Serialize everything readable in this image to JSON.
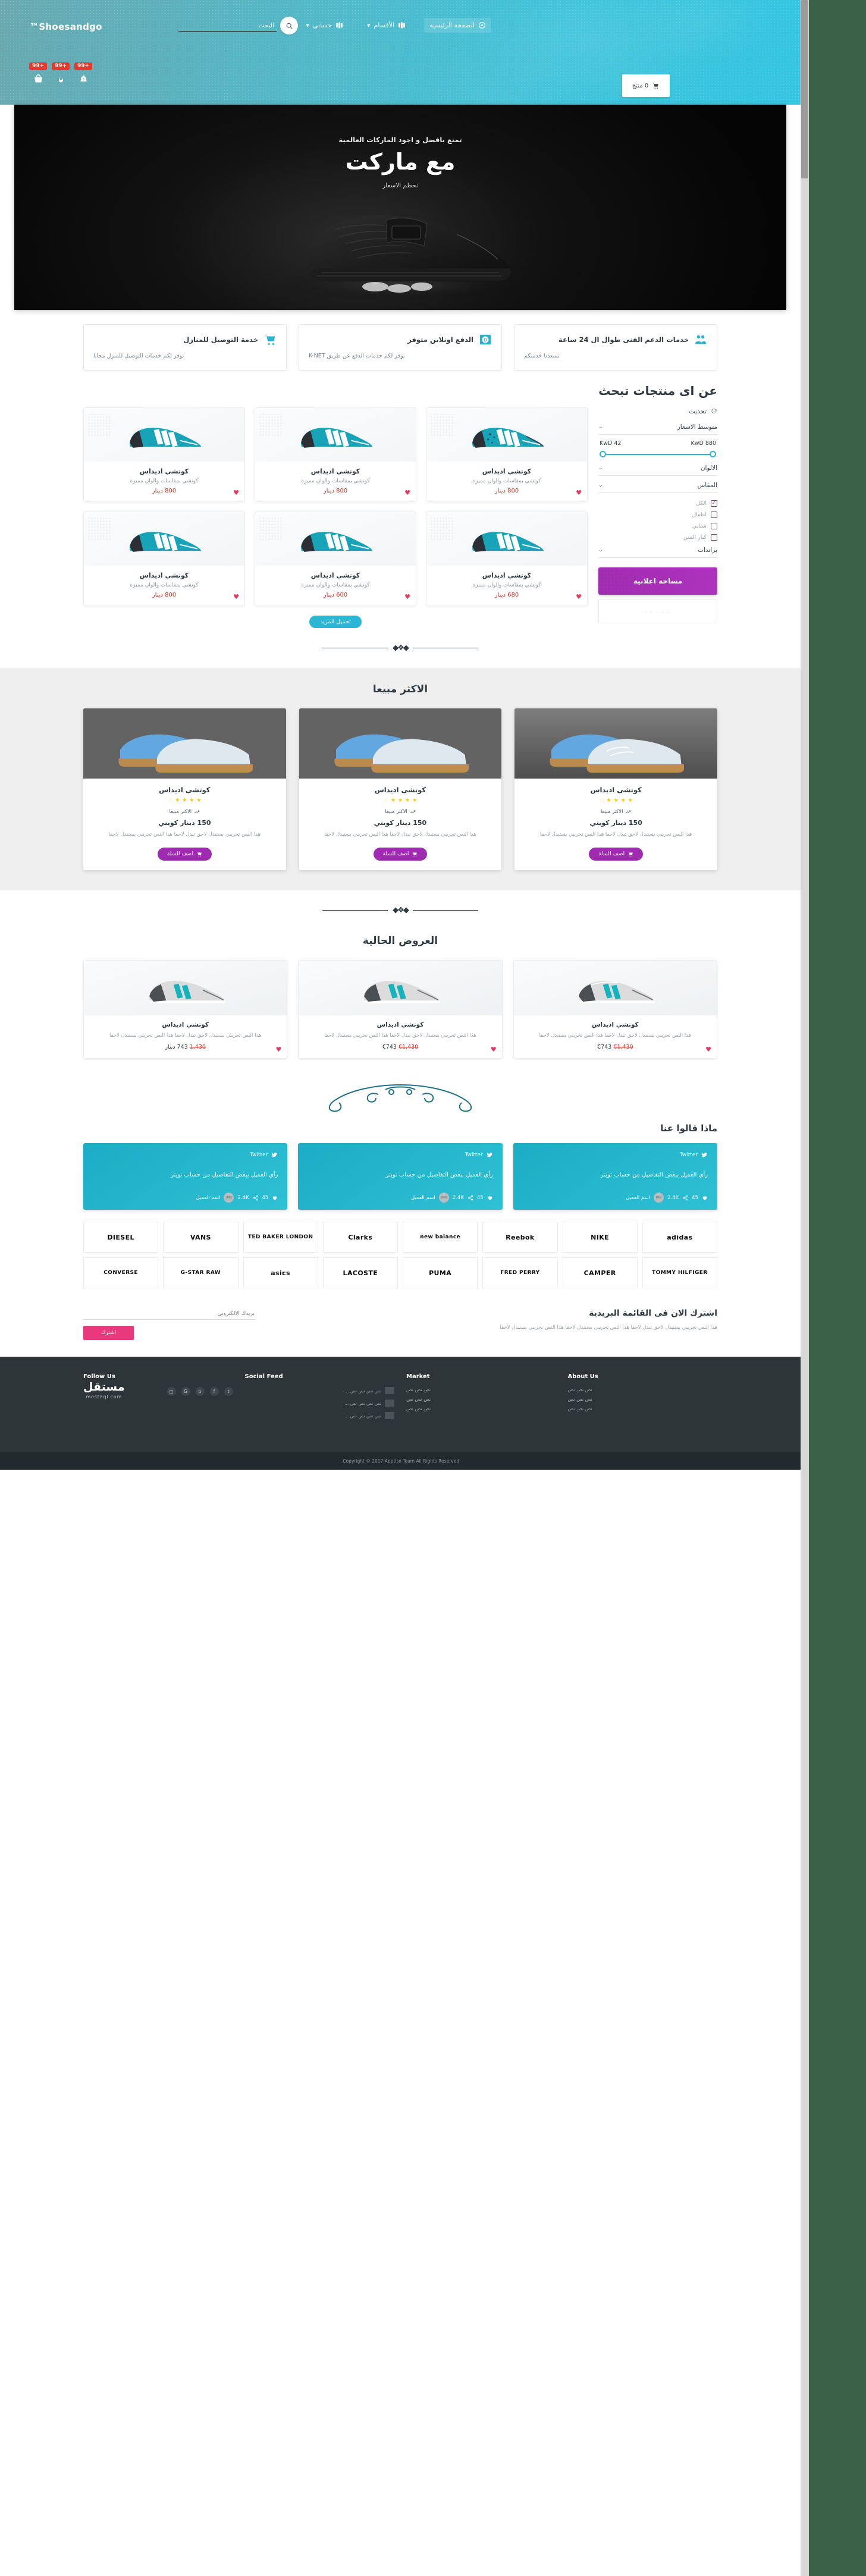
{
  "header": {
    "brand": "Shoesandgo™",
    "nav": [
      {
        "label": "الصفحة الرئيسية",
        "icon": "compass-icon",
        "active": true,
        "caret": false
      },
      {
        "label": "الأقسام",
        "icon": "grid-icon",
        "active": false,
        "caret": true
      },
      {
        "label": "حسابي",
        "icon": "grid-icon",
        "active": false,
        "caret": true
      }
    ],
    "search_placeholder": "البحث",
    "search_value": "",
    "search_icon": "search-icon",
    "badges": [
      {
        "count": "+99",
        "icon": "bell-icon"
      },
      {
        "count": "+99",
        "icon": "flame-icon"
      },
      {
        "count": "+99",
        "icon": "cart-icon"
      }
    ],
    "cart": {
      "label": "0 منتج",
      "icon": "cart-icon"
    }
  },
  "hero": {
    "sublabel": "تمتع بافضل و اجود الماركات العالمية",
    "title": "مع ماركت",
    "tagline": "نحطم الاسعار"
  },
  "features": [
    {
      "title": "خدمة التوصيل للمنازل",
      "desc": "نوفر لكم خدمات التوصيل للمنزل مجانا",
      "icon": "cart-icon"
    },
    {
      "title": "الدفع اونلاين متوفر",
      "desc": "نوفر لكم خدمات الدفع عن طريق K-NET",
      "icon": "payment-icon"
    },
    {
      "title": "خدمات الدعم الفنى طوال ال 24 ساعة",
      "desc": "تسعدنا خدمتكم",
      "icon": "users-icon"
    }
  ],
  "shop": {
    "title": "عن اى منتجات تبحث",
    "refresh_label": "تحديث",
    "refresh_icon": "refresh-icon",
    "filters": [
      {
        "label": "متوسط الاسعار",
        "type": "price"
      },
      {
        "label": "الالوان",
        "type": "plain"
      },
      {
        "label": "المقاس",
        "type": "checks"
      },
      {
        "label": "براندات",
        "type": "plain"
      }
    ],
    "price": {
      "min_label": "KwD 42",
      "max_label": "KwD 880"
    },
    "size_options": [
      {
        "label": "الكل",
        "checked": true
      },
      {
        "label": "اطفال",
        "checked": false
      },
      {
        "label": "شبابي",
        "checked": false
      },
      {
        "label": "كبار السن",
        "checked": false
      }
    ],
    "ad_label": "مساحة اعلانية",
    "ad_placeholder": ". . . . .",
    "more_label": "تحميل المزيد",
    "products": [
      {
        "name": "كوتشي اديداس",
        "desc": "كوتشي بمقاسات والوان مميزة",
        "price": "800 دينار"
      },
      {
        "name": "كوتشي اديداس",
        "desc": "كوتشي بمقاسات والوان مميزة",
        "price": "800 دينار"
      },
      {
        "name": "كوتشي اديداس",
        "desc": "كوتشي بمقاسات والوان مميزة",
        "price": "800 دينار"
      },
      {
        "name": "كوتشي اديداس",
        "desc": "كوتشي بمقاسات والوان مميزة",
        "price": "680 دينار"
      },
      {
        "name": "كوتشي اديداس",
        "desc": "كوتشي بمقاسات والوان مميزة",
        "price": "600 دينار"
      },
      {
        "name": "كوتشي اديداس",
        "desc": "كوتشي بمقاسات والوان مميزة",
        "price": "800 دينار"
      }
    ]
  },
  "bestsellers": {
    "title": "الاكثر مبيعا",
    "items": [
      {
        "name": "كوتشى اديداس",
        "rating": 4,
        "tag": "الاكثر مبيعا",
        "price": "150 دينار كويتي",
        "desc": "هذا النص تجريبي يستبدل لاحق تبدل لاحقا هذا النص تجريبي يستبدل لاحقا",
        "button": "اضف للسلة"
      },
      {
        "name": "كوتشى اديداس",
        "rating": 4,
        "tag": "الاكثر مبيعا",
        "price": "150 دينار كويتي",
        "desc": "هذا النص تجريبي يستبدل لاحق تبدل لاحقا هذا النص تجريبي يستبدل لاحقا",
        "button": "اضف للسلة"
      },
      {
        "name": "كوتشى اديداس",
        "rating": 4,
        "tag": "الاكثر مبيعا",
        "price": "150 دينار كويتي",
        "desc": "هذا النص تجريبي يستبدل لاحق تبدل لاحقا هذا النص تجريبي يستبدل لاحقا",
        "button": "اضف للسلة"
      }
    ]
  },
  "offers": {
    "title": "العروض الحالية",
    "items": [
      {
        "name": "كوتشي اديداس",
        "desc": "هذا النص تجريبي يستبدل لاحق تبدل لاحقا هذا النص تجريبي يستبدل لاحقا",
        "old_price": "€1,430",
        "new_price": "€743"
      },
      {
        "name": "كوتشي اديداس",
        "desc": "هذا النص تجريبي يستبدل لاحق تبدل لاحقا هذا النص تجريبي يستبدل لاحقا",
        "old_price": "€1,430",
        "new_price": "€743"
      },
      {
        "name": "كوتشي اديداس",
        "desc": "هذا النص تجريبي يستبدل لاحق تبدل لاحقا هذا النص تجريبي يستبدل لاحقا",
        "old_price": "1,430",
        "new_price": "743 دينار"
      }
    ]
  },
  "testimonials": {
    "title": "ماذا قالوا عنا",
    "items": [
      {
        "source": "Twitter",
        "text": "رأي العميل ببعض التفاصيل من حساب تويتر",
        "likes": "45",
        "shares": "2.4K",
        "author": "اسم العميل"
      },
      {
        "source": "Twitter",
        "text": "رأي العميل ببعض التفاصيل من حساب تويتر",
        "likes": "45",
        "shares": "2.4K",
        "author": "اسم العميل"
      },
      {
        "source": "Twitter",
        "text": "رأي العميل ببعض التفاصيل من حساب تويتر",
        "likes": "45",
        "shares": "2.4K",
        "author": "اسم العميل"
      }
    ]
  },
  "brands": {
    "row1": [
      "adidas",
      "NIKE",
      "Reebok",
      "new balance",
      "Clarks",
      "TED BAKER LONDON",
      "VANS",
      "DIESEL"
    ],
    "row2": [
      "TOMMY HILFIGER",
      "CAMPER",
      "FRED PERRY",
      "PUMA",
      "LACOSTE",
      "asics",
      "G-STAR RAW",
      "CONVERSE"
    ]
  },
  "newsletter": {
    "title": "اشترك الان فى القائمة البريدية",
    "desc": "هذا النص تجريبي يستبدل لاحق تبدل لاحقا هذا النص تجريبي يستبدل لاحقا هذا النص تجريبي يستبدل لاحقا",
    "placeholder": "بريدك الالكتروني",
    "value": "",
    "button": "اشترك"
  },
  "footer": {
    "columns": [
      {
        "title": "Follow Us",
        "type": "social",
        "items": []
      },
      {
        "title": "Social Feed",
        "type": "feed",
        "items": [
          "نص نص نص نص ...",
          "نص نص نص نص ...",
          "نص نص نص نص ..."
        ]
      },
      {
        "title": "Market",
        "type": "links",
        "items": [
          "نص نص نص",
          "نص نص نص",
          "نص نص نص"
        ]
      },
      {
        "title": "About Us",
        "type": "links",
        "items": [
          "نص نص نص",
          "نص نص نص",
          "نص نص نص"
        ]
      }
    ],
    "logo_ar": "مستقل",
    "logo_en": "mostaql.com",
    "copyright": "Copyright © 2017 Apptiso Team All Rights Reserved."
  },
  "colors": {
    "header_start": "#6aa9b0",
    "header_end": "#35c6e2",
    "accent_teal": "#2ab6d4",
    "accent_purple": "#9f2bb0",
    "badge_red": "#e8382c",
    "pink": "#e8397d",
    "footer_bg": "#2d3539",
    "page_bg": "#3c6149"
  }
}
